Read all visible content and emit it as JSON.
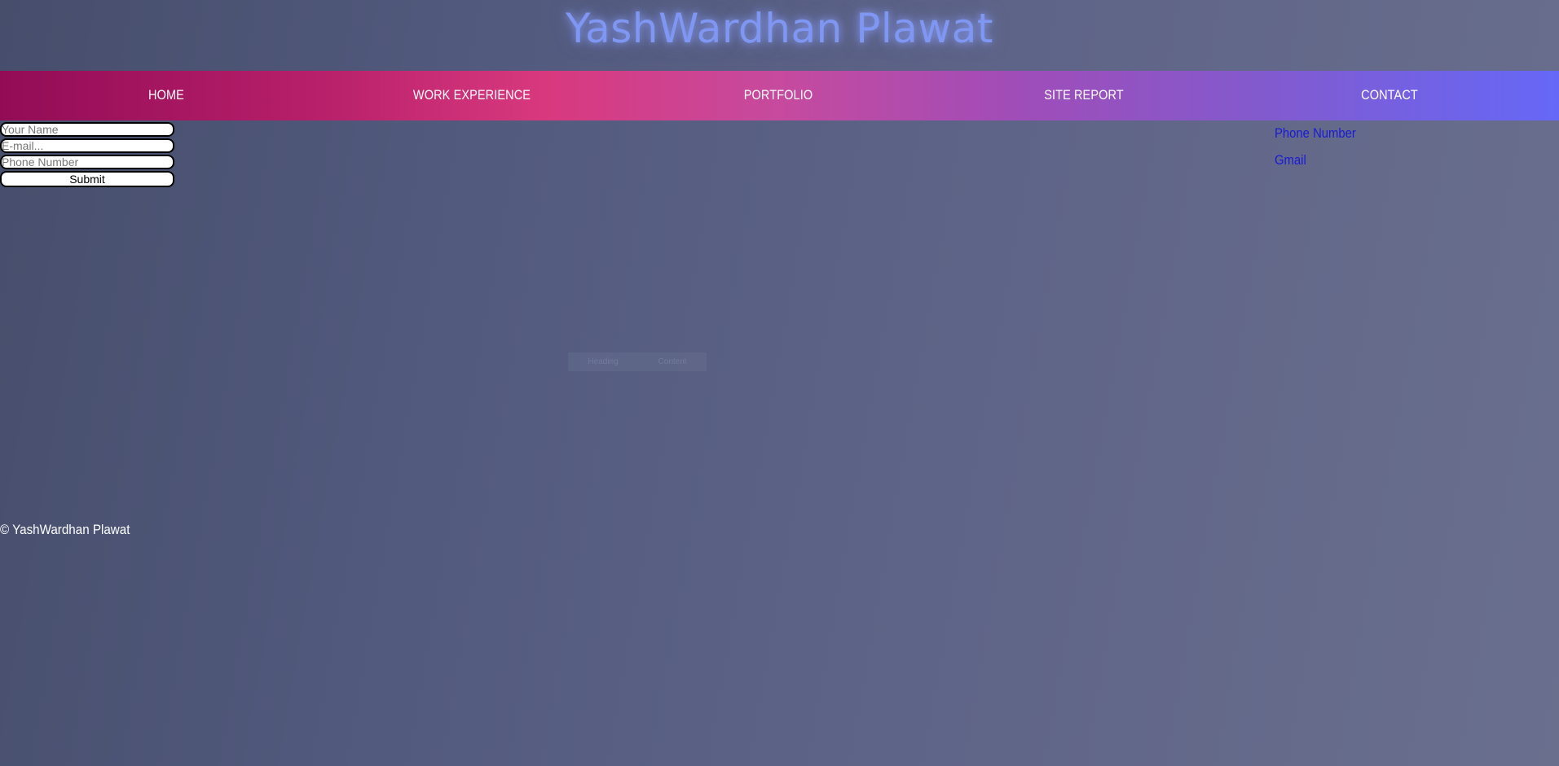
{
  "header": {
    "title": "YashWardhan Plawat"
  },
  "nav": {
    "items": [
      {
        "label": "HOME"
      },
      {
        "label": "WORK EXPERIENCE"
      },
      {
        "label": "PORTFOLIO"
      },
      {
        "label": "SITE REPORT"
      },
      {
        "label": "CONTACT"
      }
    ]
  },
  "form": {
    "name_placeholder": "Your Name",
    "name_value": "",
    "email_placeholder": "E-mail...",
    "email_value": "",
    "phone_placeholder": "Phone Number",
    "phone_value": "",
    "submit_label": "Submit"
  },
  "contact_links": {
    "phone": "Phone Number",
    "gmail": "Gmail"
  },
  "ghost_buttons": {
    "first": "Heading",
    "second": "Content"
  },
  "footer": {
    "copyright": "© YashWardhan Plawat"
  },
  "colors": {
    "title_glow": "#7f97f2",
    "nav_gradient_start": "#920c55",
    "nav_gradient_mid": "#d8397e",
    "nav_gradient_end": "#6568f7",
    "link": "#1a1ad6",
    "background": "#525a7e"
  }
}
